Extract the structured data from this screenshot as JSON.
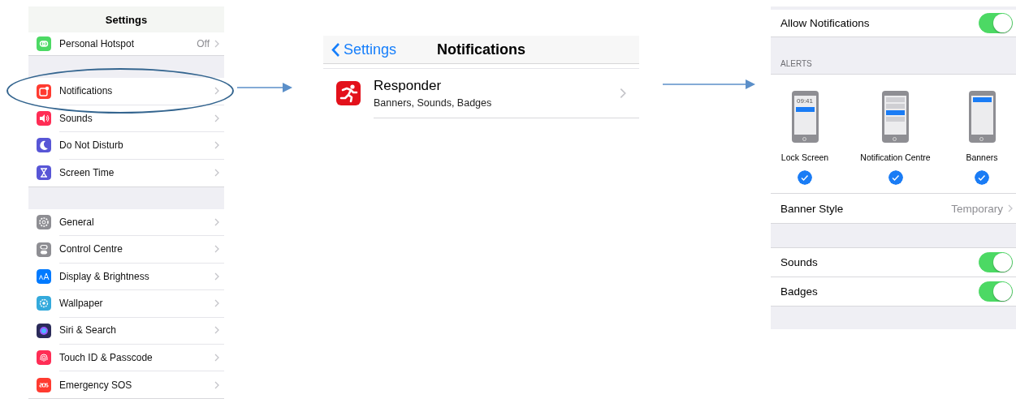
{
  "settings_screen": {
    "title": "Settings",
    "sections": [
      {
        "items": [
          {
            "label": "Personal Hotspot",
            "value": "Off",
            "highlighted": false
          }
        ]
      },
      {
        "items": [
          {
            "label": "Notifications",
            "highlighted": true
          },
          {
            "label": "Sounds",
            "highlighted": false
          },
          {
            "label": "Do Not Disturb",
            "highlighted": false
          },
          {
            "label": "Screen Time",
            "highlighted": false
          }
        ]
      },
      {
        "items": [
          {
            "label": "General",
            "highlighted": false
          },
          {
            "label": "Control Centre",
            "highlighted": false
          },
          {
            "label": "Display & Brightness",
            "highlighted": false
          },
          {
            "label": "Wallpaper",
            "highlighted": false
          },
          {
            "label": "Siri & Search",
            "highlighted": false
          },
          {
            "label": "Touch ID & Passcode",
            "highlighted": false
          },
          {
            "label": "Emergency SOS",
            "highlighted": false
          }
        ]
      }
    ]
  },
  "notifications_screen": {
    "back": "Settings",
    "title": "Notifications",
    "apps": [
      {
        "name": "Responder",
        "detail": "Banners, Sounds, Badges"
      }
    ]
  },
  "app_screen": {
    "allow": {
      "label": "Allow Notifications",
      "on": true
    },
    "alerts_header": "ALERTS",
    "alert_styles": [
      {
        "kind": "lock",
        "label": "Lock Screen",
        "time": "09:41",
        "checked": true
      },
      {
        "kind": "centre",
        "label": "Notification Centre",
        "checked": true
      },
      {
        "kind": "banner",
        "label": "Banners",
        "checked": true
      }
    ],
    "banner_style": {
      "label": "Banner Style",
      "value": "Temporary"
    },
    "toggles": [
      {
        "label": "Sounds",
        "on": true
      },
      {
        "label": "Badges",
        "on": true
      }
    ]
  }
}
